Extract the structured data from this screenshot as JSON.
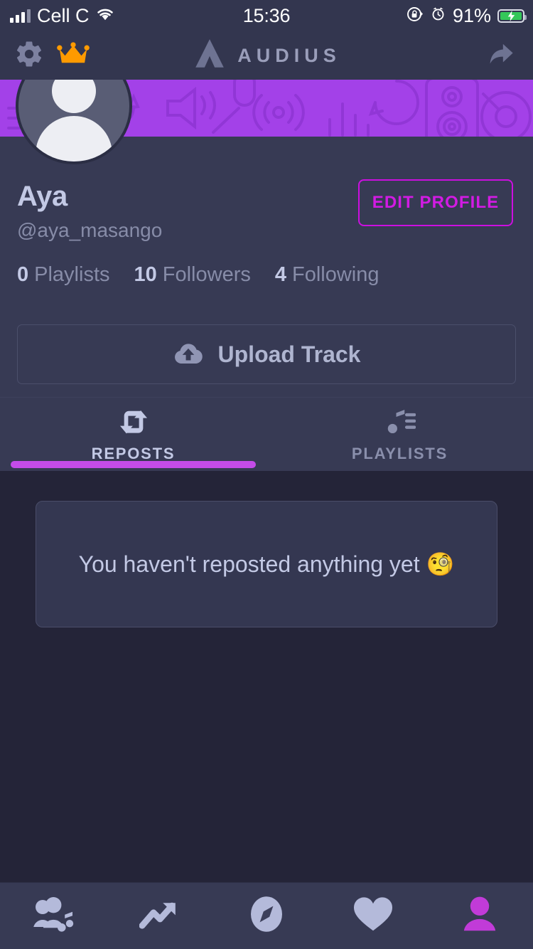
{
  "status_bar": {
    "carrier": "Cell C",
    "time": "15:36",
    "battery_percent": "91%",
    "icons": [
      "signal-bars-icon",
      "wifi-icon",
      "rotation-lock-icon",
      "alarm-clock-icon",
      "battery-charging-icon"
    ]
  },
  "header": {
    "settings_icon": "gear-icon",
    "crown_icon": "crown-icon",
    "logo_icon": "audius-logo-icon",
    "logo_text": "AUDIUS",
    "share_icon": "share-arrow-icon"
  },
  "profile": {
    "display_name": "Aya",
    "handle": "@aya_masango",
    "edit_label": "EDIT PROFILE",
    "avatar_icon": "default-user-avatar-icon",
    "stats": [
      {
        "count": "0",
        "label": "Playlists"
      },
      {
        "count": "10",
        "label": "Followers"
      },
      {
        "count": "4",
        "label": "Following"
      }
    ],
    "upload_label": "Upload Track",
    "upload_icon": "cloud-upload-icon"
  },
  "tabs": [
    {
      "label": "REPOSTS",
      "icon": "repost-icon",
      "active": true
    },
    {
      "label": "PLAYLISTS",
      "icon": "playlist-icon",
      "active": false
    }
  ],
  "content": {
    "empty_message": "You haven't reposted anything yet 🧐"
  },
  "bottom_nav": [
    {
      "name": "feed",
      "icon": "people-music-icon",
      "active": false
    },
    {
      "name": "trending",
      "icon": "trending-arrow-icon",
      "active": false
    },
    {
      "name": "explore",
      "icon": "compass-icon",
      "active": false
    },
    {
      "name": "favorites",
      "icon": "heart-icon",
      "active": false
    },
    {
      "name": "profile",
      "icon": "person-icon",
      "active": true
    }
  ],
  "colors": {
    "banner_purple": "#A341E8",
    "accent_magenta": "#CC0FE0",
    "tab_indicator": "#C44CE8",
    "active_nav": "#C13BD8",
    "crown_orange": "#FF9A00",
    "header_bg": "#33364F",
    "profile_bg": "#373A54",
    "content_bg": "#242438",
    "text_primary": "#C3C9E5",
    "text_muted": "#878CA8",
    "battery_green": "#34C759"
  }
}
